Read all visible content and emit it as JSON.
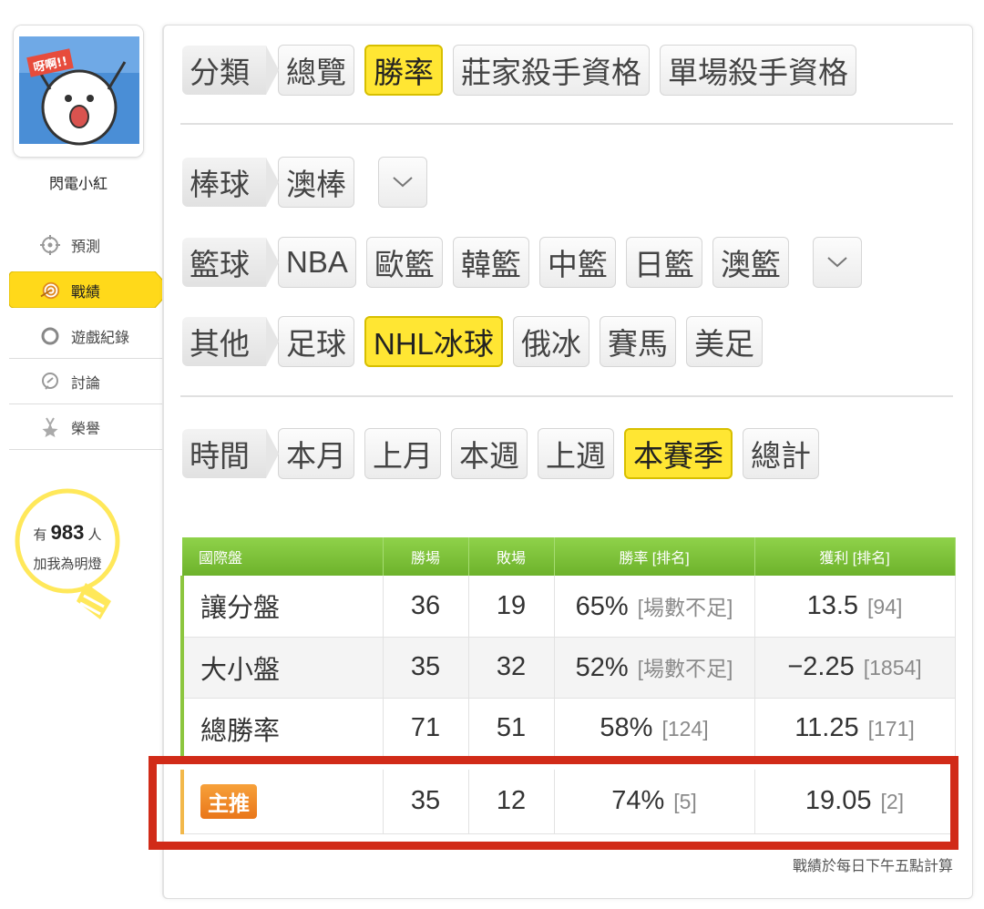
{
  "user": {
    "name": "閃電小紅",
    "avatar_caption": "呀啊!!"
  },
  "sidebar": {
    "items": [
      {
        "label": "預測",
        "icon": "crosshair-icon"
      },
      {
        "label": "戰績",
        "icon": "target-icon",
        "active": true
      },
      {
        "label": "遊戲紀錄",
        "icon": "circle-icon"
      },
      {
        "label": "討論",
        "icon": "chat-icon"
      },
      {
        "label": "榮譽",
        "icon": "medal-icon"
      }
    ]
  },
  "follow": {
    "prefix": "有",
    "count": "983",
    "suffix": "人",
    "line2": "加我為明燈"
  },
  "filters": {
    "category": {
      "label": "分類",
      "options": [
        "總覽",
        "勝率",
        "莊家殺手資格",
        "單場殺手資格"
      ],
      "selected": "勝率"
    },
    "baseball": {
      "label": "棒球",
      "options": [
        "澳棒"
      ]
    },
    "basketball": {
      "label": "籃球",
      "options": [
        "NBA",
        "歐籃",
        "韓籃",
        "中籃",
        "日籃",
        "澳籃"
      ]
    },
    "other": {
      "label": "其他",
      "options": [
        "足球",
        "NHL冰球",
        "俄冰",
        "賽馬",
        "美足"
      ],
      "selected": "NHL冰球"
    },
    "time": {
      "label": "時間",
      "options": [
        "本月",
        "上月",
        "本週",
        "上週",
        "本賽季",
        "總計"
      ],
      "selected": "本賽季"
    }
  },
  "table": {
    "headers": [
      "國際盤",
      "勝場",
      "敗場",
      "勝率 [排名]",
      "獲利 [排名]"
    ],
    "rows": [
      {
        "name": "讓分盤",
        "wins": "36",
        "losses": "19",
        "rate": "65%",
        "rate_rank": "[場數不足]",
        "profit": "13.5",
        "profit_rank": "[94]"
      },
      {
        "name": "大小盤",
        "wins": "35",
        "losses": "32",
        "rate": "52%",
        "rate_rank": "[場數不足]",
        "profit": "−2.25",
        "profit_rank": "[1854]"
      },
      {
        "name": "總勝率",
        "wins": "71",
        "losses": "51",
        "rate": "58%",
        "rate_rank": "[124]",
        "profit": "11.25",
        "profit_rank": "[171]"
      }
    ],
    "main_row": {
      "badge": "主推",
      "wins": "35",
      "losses": "12",
      "rate": "74%",
      "rate_rank": "[5]",
      "profit": "19.05",
      "profit_rank": "[2]"
    },
    "footnote": "戰績於每日下午五點計算"
  },
  "colors": {
    "accent_yellow": "#ffe633",
    "header_green": "#7bbf35",
    "highlight_red": "#d12b18",
    "badge_orange": "#ee8424"
  }
}
